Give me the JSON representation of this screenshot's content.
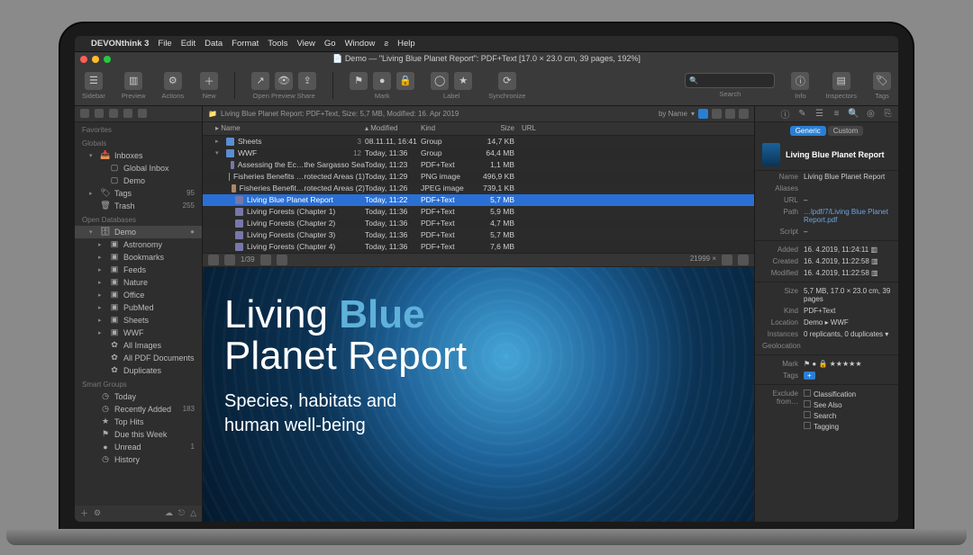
{
  "menubar": {
    "app": "DEVONthink 3",
    "items": [
      "File",
      "Edit",
      "Data",
      "Format",
      "Tools",
      "View",
      "Go",
      "Window",
      "Help"
    ]
  },
  "titlebar": "Demo — \"Living Blue Planet Report\": PDF+Text [17.0 × 23.0 cm, 39 pages, 192%]",
  "toolbar": {
    "groups": [
      {
        "icons": [
          "sidebar"
        ],
        "label": "Sidebar"
      },
      {
        "icons": [
          "preview"
        ],
        "label": "Preview"
      },
      {
        "icons": [
          "actions"
        ],
        "label": "Actions"
      },
      {
        "icons": [
          "new"
        ],
        "label": "New"
      },
      {
        "icons": [
          "open",
          "preview2",
          "share"
        ],
        "label": "Open   Preview   Share",
        "split": true
      },
      {
        "icons": [
          "mark"
        ],
        "label": "Mark"
      },
      {
        "icons": [
          "label"
        ],
        "label": "Label"
      },
      {
        "icons": [
          "sync"
        ],
        "label": "Synchronize"
      }
    ],
    "right": [
      {
        "icons": [
          "info"
        ],
        "label": "Info"
      },
      {
        "icons": [
          "inspectors"
        ],
        "label": "Inspectors"
      },
      {
        "icons": [
          "tags"
        ],
        "label": "Tags"
      }
    ],
    "search_placeholder": "Search"
  },
  "sidebar": {
    "sections": [
      {
        "title": "Favorites",
        "items": []
      },
      {
        "title": "Globals",
        "items": [
          {
            "icon": "inbox",
            "label": "Inboxes",
            "expandable": true,
            "expanded": true,
            "badge": ""
          },
          {
            "icon": "tray",
            "label": "Global Inbox",
            "indent": 1
          },
          {
            "icon": "tray",
            "label": "Demo",
            "indent": 1
          },
          {
            "icon": "tag",
            "label": "Tags",
            "expandable": true,
            "badge": "95"
          },
          {
            "icon": "trash",
            "label": "Trash",
            "badge": "255"
          }
        ]
      },
      {
        "title": "Open Databases",
        "items": [
          {
            "icon": "db",
            "label": "Demo",
            "selected": true,
            "expandable": true,
            "expanded": true,
            "badge": "●"
          },
          {
            "icon": "folder",
            "label": "Astronomy",
            "indent": 1,
            "expandable": true
          },
          {
            "icon": "folder",
            "label": "Bookmarks",
            "indent": 1,
            "expandable": true
          },
          {
            "icon": "folder",
            "label": "Feeds",
            "indent": 1,
            "expandable": true
          },
          {
            "icon": "folder",
            "label": "Nature",
            "indent": 1,
            "expandable": true
          },
          {
            "icon": "folder",
            "label": "Office",
            "indent": 1,
            "expandable": true
          },
          {
            "icon": "folder",
            "label": "PubMed",
            "indent": 1,
            "expandable": true
          },
          {
            "icon": "folder",
            "label": "Sheets",
            "indent": 1,
            "expandable": true
          },
          {
            "icon": "folder",
            "label": "WWF",
            "indent": 1,
            "expandable": true
          },
          {
            "icon": "smart",
            "label": "All Images",
            "indent": 1
          },
          {
            "icon": "smart",
            "label": "All PDF Documents",
            "indent": 1
          },
          {
            "icon": "smart",
            "label": "Duplicates",
            "indent": 1
          }
        ]
      },
      {
        "title": "Smart Groups",
        "items": [
          {
            "icon": "clock",
            "label": "Today"
          },
          {
            "icon": "clock",
            "label": "Recently Added",
            "badge": "183"
          },
          {
            "icon": "star",
            "label": "Top Hits"
          },
          {
            "icon": "flag",
            "label": "Due this Week"
          },
          {
            "icon": "dot",
            "label": "Unread",
            "badge": "1"
          },
          {
            "icon": "clock",
            "label": "History"
          }
        ]
      }
    ]
  },
  "pathbar": {
    "text": "Living Blue Planet Report: PDF+Text, Size: 5,7 MB, Modified: 16. Apr 2019",
    "sort": "by Name"
  },
  "columns": [
    "Name",
    "Modified",
    "Kind",
    "Size",
    "URL"
  ],
  "files": [
    {
      "tri": "▸",
      "icon": "grp",
      "name": "Sheets",
      "count": "3",
      "mod": "08.11.11, 16:41",
      "kind": "Group",
      "size": "14,7 KB"
    },
    {
      "tri": "▾",
      "icon": "grp",
      "name": "WWF",
      "count": "12",
      "mod": "Today, 11:36",
      "kind": "Group",
      "size": "64,4 MB"
    },
    {
      "indent": 1,
      "icon": "pdf",
      "name": "Assessing the Ec…the Sargasso Sea",
      "mod": "Today, 11:23",
      "kind": "PDF+Text",
      "size": "1,1 MB"
    },
    {
      "indent": 1,
      "icon": "png",
      "name": "Fisheries Benefits …rotected Areas (1)",
      "mod": "Today, 11:29",
      "kind": "PNG image",
      "size": "496,9 KB"
    },
    {
      "indent": 1,
      "icon": "jpg",
      "name": "Fisheries Benefit…rotected Areas (2)",
      "mod": "Today, 11:26",
      "kind": "JPEG image",
      "size": "739,1 KB"
    },
    {
      "indent": 1,
      "icon": "pdf",
      "name": "Living Blue Planet Report",
      "mod": "Today, 11:22",
      "kind": "PDF+Text",
      "size": "5,7 MB",
      "selected": true
    },
    {
      "indent": 1,
      "icon": "pdf",
      "name": "Living Forests (Chapter 1)",
      "mod": "Today, 11:36",
      "kind": "PDF+Text",
      "size": "5,9 MB"
    },
    {
      "indent": 1,
      "icon": "pdf",
      "name": "Living Forests (Chapter 2)",
      "mod": "Today, 11:36",
      "kind": "PDF+Text",
      "size": "4,7 MB"
    },
    {
      "indent": 1,
      "icon": "pdf",
      "name": "Living Forests (Chapter 3)",
      "mod": "Today, 11:36",
      "kind": "PDF+Text",
      "size": "5,7 MB"
    },
    {
      "indent": 1,
      "icon": "pdf",
      "name": "Living Forests (Chapter 4)",
      "mod": "Today, 11:36",
      "kind": "PDF+Text",
      "size": "7,6 MB"
    }
  ],
  "previewbar": {
    "page": "1/39",
    "zoom": "21999 ×"
  },
  "preview": {
    "title_a": "Living ",
    "title_b": "Blue",
    "title_c": "Planet Report",
    "sub": "Species, habitats and\nhuman well-being"
  },
  "inspector": {
    "tabs": [
      "Generic",
      "Custom"
    ],
    "title": "Living Blue Planet Report",
    "rows": [
      {
        "label": "Name",
        "val": "Living Blue Planet Report"
      },
      {
        "label": "Aliases",
        "val": ""
      },
      {
        "label": "URL",
        "val": "–"
      },
      {
        "label": "Path",
        "val": "…lpdf/7/Living Blue Planet Report.pdf",
        "link": true
      }
    ],
    "script": "–",
    "meta": [
      {
        "label": "Added",
        "val": "16.  4.2019, 11:24:11"
      },
      {
        "label": "Created",
        "val": "16.  4.2019, 11:22:58"
      },
      {
        "label": "Modified",
        "val": "16.  4.2019, 11:22:58"
      }
    ],
    "props": [
      {
        "label": "Size",
        "val": "5,7 MB, 17.0 × 23.0 cm, 39 pages"
      },
      {
        "label": "Kind",
        "val": "PDF+Text"
      },
      {
        "label": "Location",
        "val": "Demo ▸ WWF"
      },
      {
        "label": "Instances",
        "val": "0 replicants, 0 duplicates"
      },
      {
        "label": "Geolocation",
        "val": ""
      }
    ],
    "mark_label": "Mark",
    "tags_label": "Tags",
    "tags_add": "+",
    "exclude_label": "Exclude from…",
    "exclude": [
      "Classification",
      "See Also",
      "Search",
      "Tagging"
    ]
  }
}
